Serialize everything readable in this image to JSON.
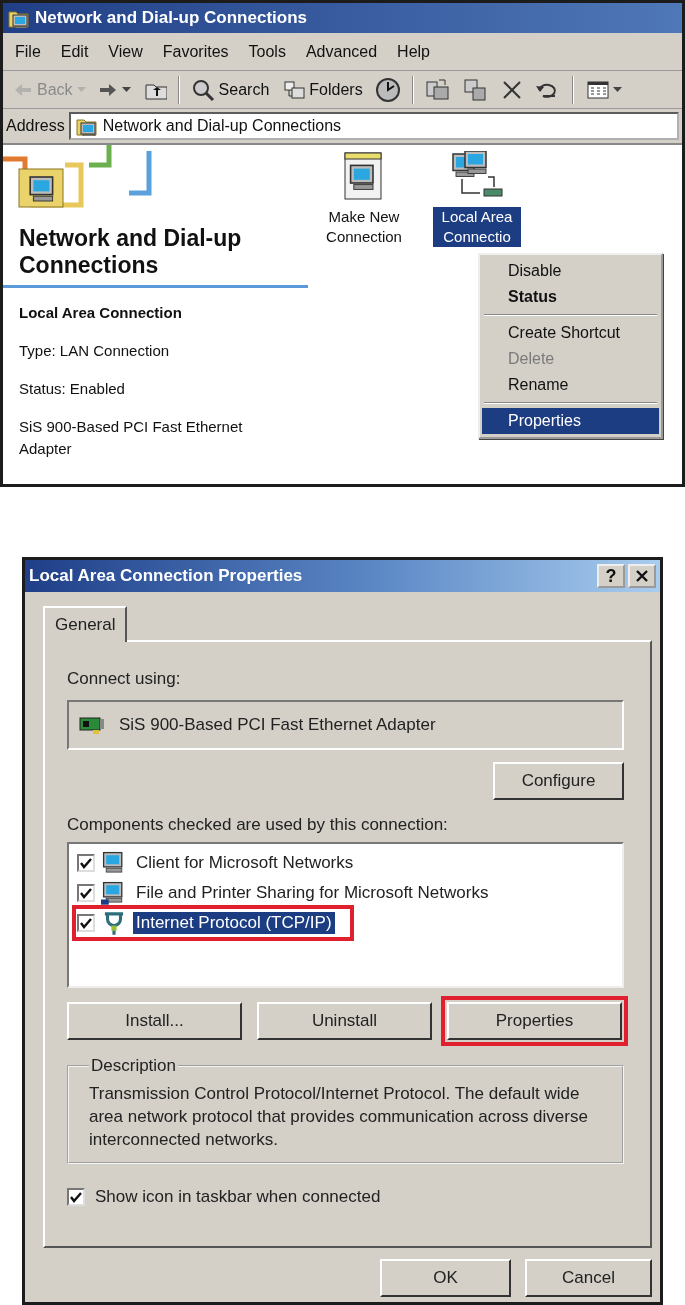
{
  "explorer": {
    "title": "Network and Dial-up Connections",
    "menu": [
      "File",
      "Edit",
      "View",
      "Favorites",
      "Tools",
      "Advanced",
      "Help"
    ],
    "toolbar": [
      {
        "kind": "back",
        "label": "Back",
        "disabled": true,
        "dropdown": true
      },
      {
        "kind": "forward",
        "disabled": false,
        "dropdown": true
      },
      {
        "kind": "up",
        "disabled": false,
        "dropdown": false
      },
      {
        "kind": "separator",
        "disabled": false
      },
      {
        "kind": "search",
        "label": "Search",
        "disabled": false,
        "dropdown": false
      },
      {
        "kind": "folders",
        "label": "Folders",
        "disabled": false,
        "dropdown": false
      },
      {
        "kind": "history",
        "disabled": false,
        "dropdown": false
      },
      {
        "kind": "separator",
        "disabled": false
      },
      {
        "kind": "move",
        "disabled": false,
        "dropdown": false
      },
      {
        "kind": "copy",
        "disabled": false,
        "dropdown": false
      },
      {
        "kind": "delete",
        "disabled": false,
        "dropdown": false
      },
      {
        "kind": "undo",
        "disabled": false,
        "dropdown": false
      },
      {
        "kind": "separator",
        "disabled": false
      },
      {
        "kind": "views",
        "disabled": false,
        "dropdown": true
      }
    ],
    "address": {
      "label": "Address",
      "value": "Network and Dial-up Connections"
    },
    "heading": "Network and Dial-up Connections",
    "details": [
      {
        "kind": "title",
        "text": "Local Area Connection"
      },
      {
        "kind": "text",
        "text": "Type: LAN Connection"
      },
      {
        "kind": "text",
        "text": "Status: Enabled"
      },
      {
        "kind": "text",
        "text": "SiS 900-Based PCI Fast Ethernet Adapter"
      }
    ],
    "items": [
      {
        "kind": "new",
        "label": "Make New Connection",
        "selected": false
      },
      {
        "kind": "lan",
        "label": "Local Area Connectio",
        "selected": true
      }
    ],
    "context_menu": [
      {
        "kind": "item",
        "label": "Disable",
        "default": false,
        "disabled": false,
        "selected": false
      },
      {
        "kind": "item",
        "label": "Status",
        "default": true,
        "disabled": false,
        "selected": false
      },
      {
        "kind": "separator"
      },
      {
        "kind": "item",
        "label": "Create Shortcut",
        "default": false,
        "disabled": false,
        "selected": false
      },
      {
        "kind": "item",
        "label": "Delete",
        "default": false,
        "disabled": true,
        "selected": false
      },
      {
        "kind": "item",
        "label": "Rename",
        "default": false,
        "disabled": false,
        "selected": false
      },
      {
        "kind": "separator"
      },
      {
        "kind": "item",
        "label": "Properties",
        "default": false,
        "disabled": false,
        "selected": true
      }
    ]
  },
  "dialog": {
    "title": "Local Area Connection Properties",
    "help_button": "?",
    "tabs": [
      {
        "label": "General",
        "selected": true
      }
    ],
    "connect_label": "Connect using:",
    "adapter": "SiS 900-Based PCI Fast Ethernet Adapter",
    "configure": "Configure",
    "components_label": "Components checked are used by this connection:",
    "components": [
      {
        "kind": "client",
        "label": "Client for Microsoft Networks",
        "checked": true,
        "selected": false,
        "highlighted": false
      },
      {
        "kind": "sharing",
        "label": "File and Printer Sharing for Microsoft Networks",
        "checked": true,
        "selected": false,
        "highlighted": false
      },
      {
        "kind": "protocol",
        "label": "Internet Protocol (TCP/IP)",
        "checked": true,
        "selected": true,
        "highlighted": true
      }
    ],
    "buttons": [
      {
        "label": "Install...",
        "highlighted": false
      },
      {
        "label": "Uninstall",
        "highlighted": false
      },
      {
        "label": "Properties",
        "highlighted": true
      }
    ],
    "description": {
      "legend": "Description",
      "text": "Transmission Control Protocol/Internet Protocol. The default wide area network protocol that provides communication across diverse interconnected networks."
    },
    "taskbar_option": {
      "label": "Show icon in taskbar when connected",
      "checked": true
    },
    "footer_buttons": [
      "OK",
      "Cancel"
    ]
  }
}
